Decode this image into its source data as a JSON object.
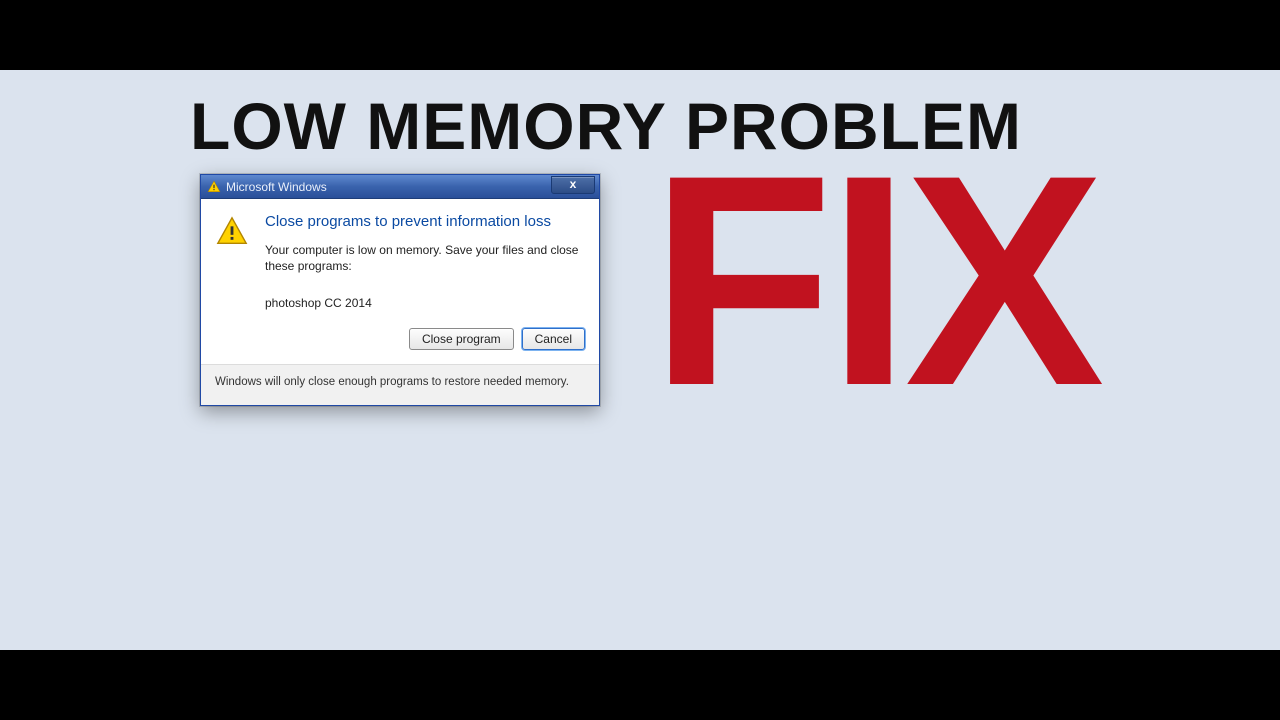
{
  "overlay": {
    "headline": "LOW MEMORY PROBLEM",
    "fix": "FIX"
  },
  "dialog": {
    "titlebar": "Microsoft Windows",
    "close_label": "x",
    "heading": "Close programs to prevent information loss",
    "message": "Your computer is low on memory. Save your files and close these programs:",
    "program": "photoshop CC 2014",
    "close_program_btn": "Close program",
    "cancel_btn": "Cancel",
    "footer": "Windows will only close enough programs to restore needed memory."
  }
}
